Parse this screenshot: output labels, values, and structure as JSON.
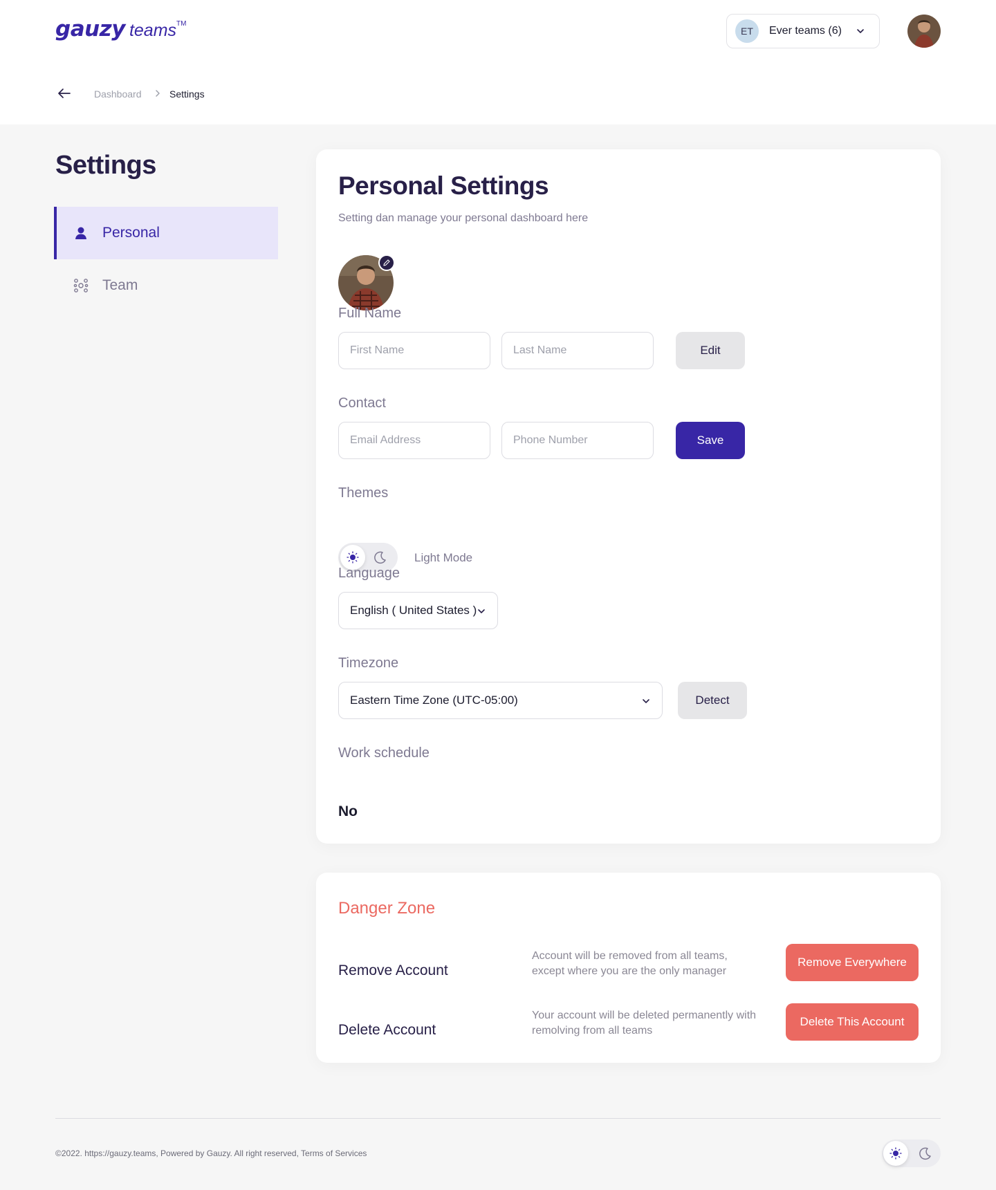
{
  "header": {
    "logo_brand": "gauzy",
    "logo_sub": "teams",
    "logo_tm": "TM",
    "team": {
      "initials": "ET",
      "name": "Ever teams (6)"
    }
  },
  "breadcrumb": {
    "items": [
      "Dashboard",
      "Settings"
    ]
  },
  "sidebar": {
    "title": "Settings",
    "items": [
      {
        "label": "Personal",
        "icon": "user-icon"
      },
      {
        "label": "Team",
        "icon": "team-icon"
      }
    ]
  },
  "personal": {
    "title": "Personal Settings",
    "subtitle": "Setting dan manage your personal dashboard here",
    "full_name": {
      "label": "Full Name",
      "first_placeholder": "First Name",
      "last_placeholder": "Last Name",
      "button": "Edit"
    },
    "contact": {
      "label": "Contact",
      "email_placeholder": "Email Address",
      "phone_placeholder": "Phone Number",
      "button": "Save"
    },
    "themes": {
      "label": "Themes",
      "mode": "Light Mode"
    },
    "language": {
      "label": "Language",
      "value": "English ( United States )"
    },
    "timezone": {
      "label": "Timezone",
      "value": "Eastern Time Zone (UTC-05:00)",
      "button": "Detect"
    },
    "work_schedule": {
      "label": "Work schedule",
      "value": "No"
    }
  },
  "danger": {
    "title": "Danger Zone",
    "remove": {
      "label": "Remove Account",
      "desc": "Account will be removed from all teams, except where you are the only manager",
      "button": "Remove Everywhere"
    },
    "delete": {
      "label": "Delete Account",
      "desc": "Your account will be deleted permanently with remolving from all teams",
      "button": "Delete This Account"
    }
  },
  "footer": {
    "text": "©2022. https://gauzy.teams, Powered by Gauzy. All right reserved, Terms of Services"
  },
  "colors": {
    "primary": "#3826a6",
    "danger": "#eb6961",
    "background": "#f6f6f6"
  }
}
